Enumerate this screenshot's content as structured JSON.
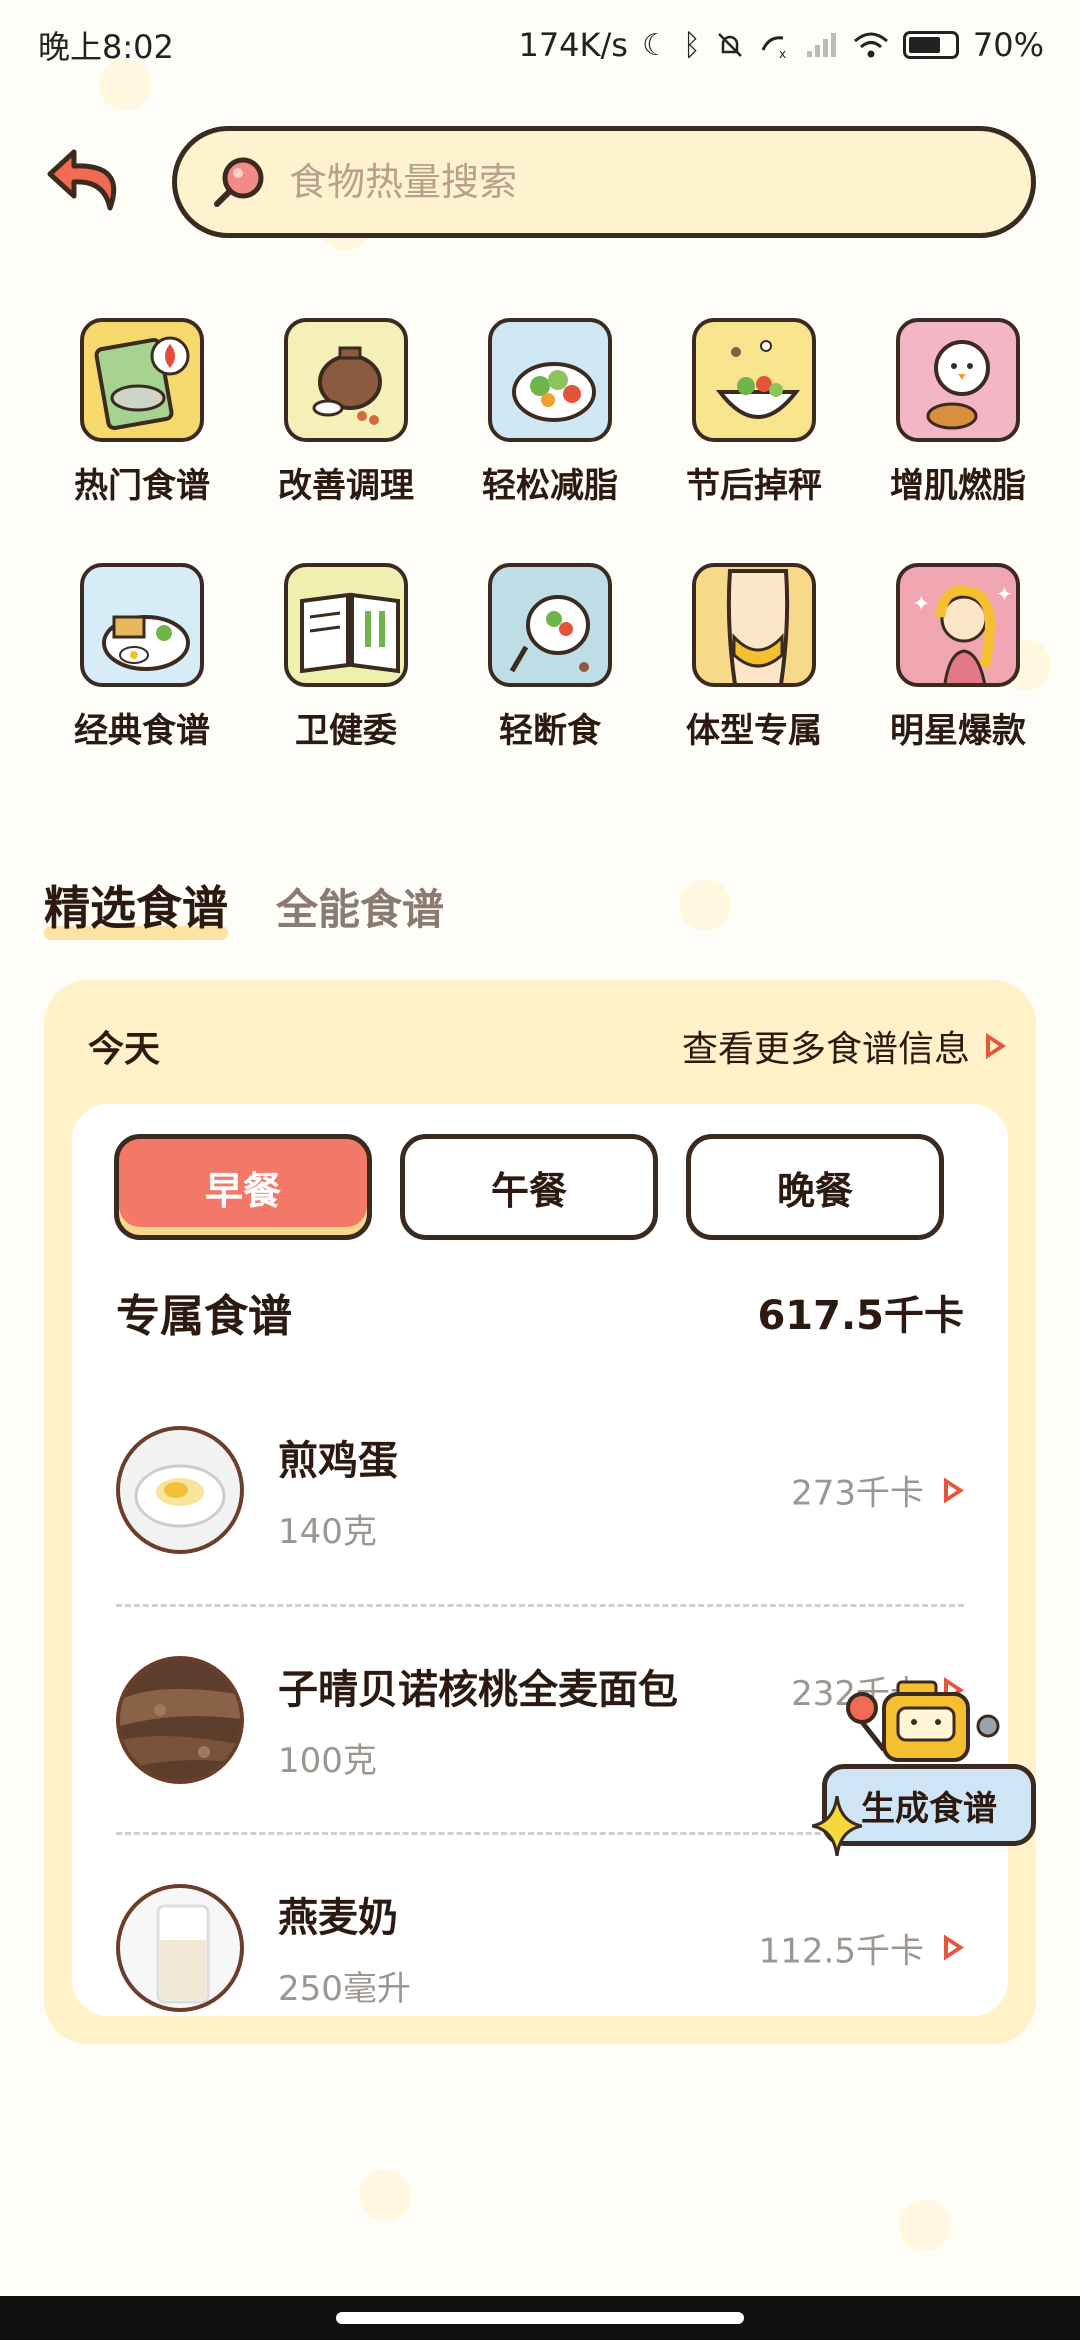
{
  "status_bar": {
    "time": "晚上8:02",
    "network_speed": "174K/s",
    "battery": "70%"
  },
  "search": {
    "placeholder": "食物热量搜索"
  },
  "categories": [
    {
      "label": "热门食谱",
      "icon": "hot-recipe-icon"
    },
    {
      "label": "改善调理",
      "icon": "conditioning-pot-icon"
    },
    {
      "label": "轻松减脂",
      "icon": "salad-icon"
    },
    {
      "label": "节后掉秤",
      "icon": "bowl-salad-icon"
    },
    {
      "label": "增肌燃脂",
      "icon": "muscle-chick-icon"
    },
    {
      "label": "经典食谱",
      "icon": "classic-plate-icon"
    },
    {
      "label": "卫健委",
      "icon": "open-book-icon"
    },
    {
      "label": "轻断食",
      "icon": "fasting-plate-icon"
    },
    {
      "label": "体型专属",
      "icon": "body-shape-icon"
    },
    {
      "label": "明星爆款",
      "icon": "star-celebrity-icon"
    }
  ],
  "section_tabs": {
    "active": "精选食谱",
    "inactive": "全能食谱"
  },
  "card": {
    "today": "今天",
    "more": "查看更多食谱信息",
    "meal_tabs": [
      "早餐",
      "午餐",
      "晚餐"
    ],
    "exclusive_title": "专属食谱",
    "exclusive_total": "617.5千卡",
    "foods": [
      {
        "name": "煎鸡蛋",
        "amount": "140克",
        "kcal": "273千卡"
      },
      {
        "name": "子晴贝诺核桃全麦面包",
        "amount": "100克",
        "kcal": "232千卡"
      },
      {
        "name": "燕麦奶",
        "amount": "250毫升",
        "kcal": "112.5千卡"
      }
    ]
  },
  "fab": {
    "label": "生成食谱"
  },
  "colors": {
    "accent": "#f37868",
    "card_bg": "#fff2c8",
    "outline": "#3b2a1f"
  }
}
